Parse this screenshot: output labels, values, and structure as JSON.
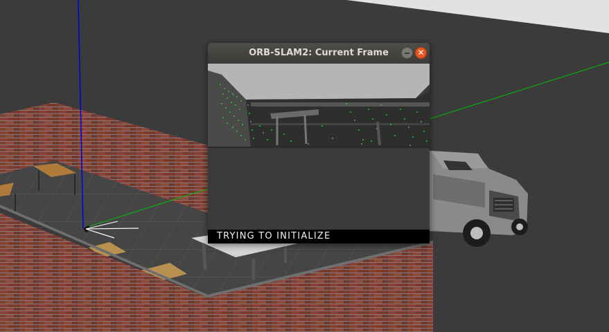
{
  "window": {
    "title": "ORB-SLAM2: Current Frame",
    "minimize_icon": "minimize-icon",
    "close_icon": "close-icon",
    "close_glyph": "✕"
  },
  "frame": {
    "status": "TRYING TO INITIALIZE",
    "feature_color": "#22cc22"
  },
  "scene": {
    "x_axis_color": "#00d000",
    "z_axis_color": "#0000dd",
    "ground_color": "#3b3b3b",
    "wall_color": "#7a3a30"
  }
}
